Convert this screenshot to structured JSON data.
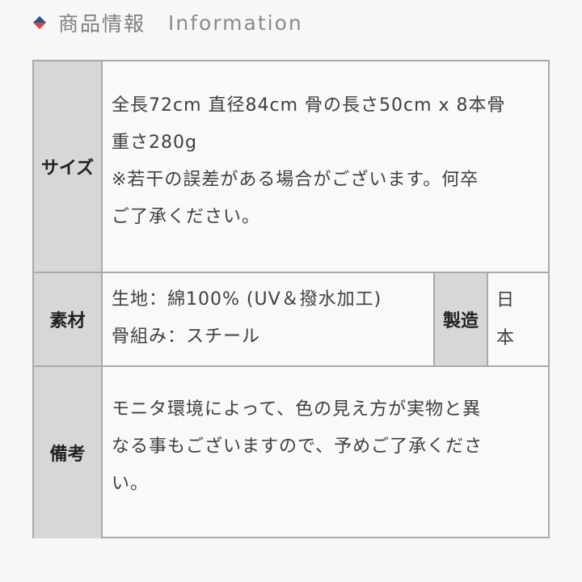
{
  "header": {
    "title_jp": "商品情報",
    "title_en": "Information",
    "colors": {
      "diamond_top": "#2d4f8e",
      "diamond_bottom": "#d44536"
    }
  },
  "table": {
    "size": {
      "label": "サイズ",
      "lines": [
        "全長72cm 直径84cm 骨の長さ50cm x 8本骨",
        "重さ280g",
        "※若干の誤差がある場合がございます。何卒",
        "ご了承ください。"
      ]
    },
    "material": {
      "label": "素材",
      "lines": [
        "生地：綿100% (UV＆撥水加工)",
        "骨組み：スチール"
      ],
      "origin_label": "製造",
      "origin_value": [
        "日",
        "本"
      ]
    },
    "notes": {
      "label": "備考",
      "lines": [
        "モニタ環境によって、色の見え方が実物と異",
        "なる事もございますので、予めご了承くださ",
        "い。"
      ]
    }
  }
}
